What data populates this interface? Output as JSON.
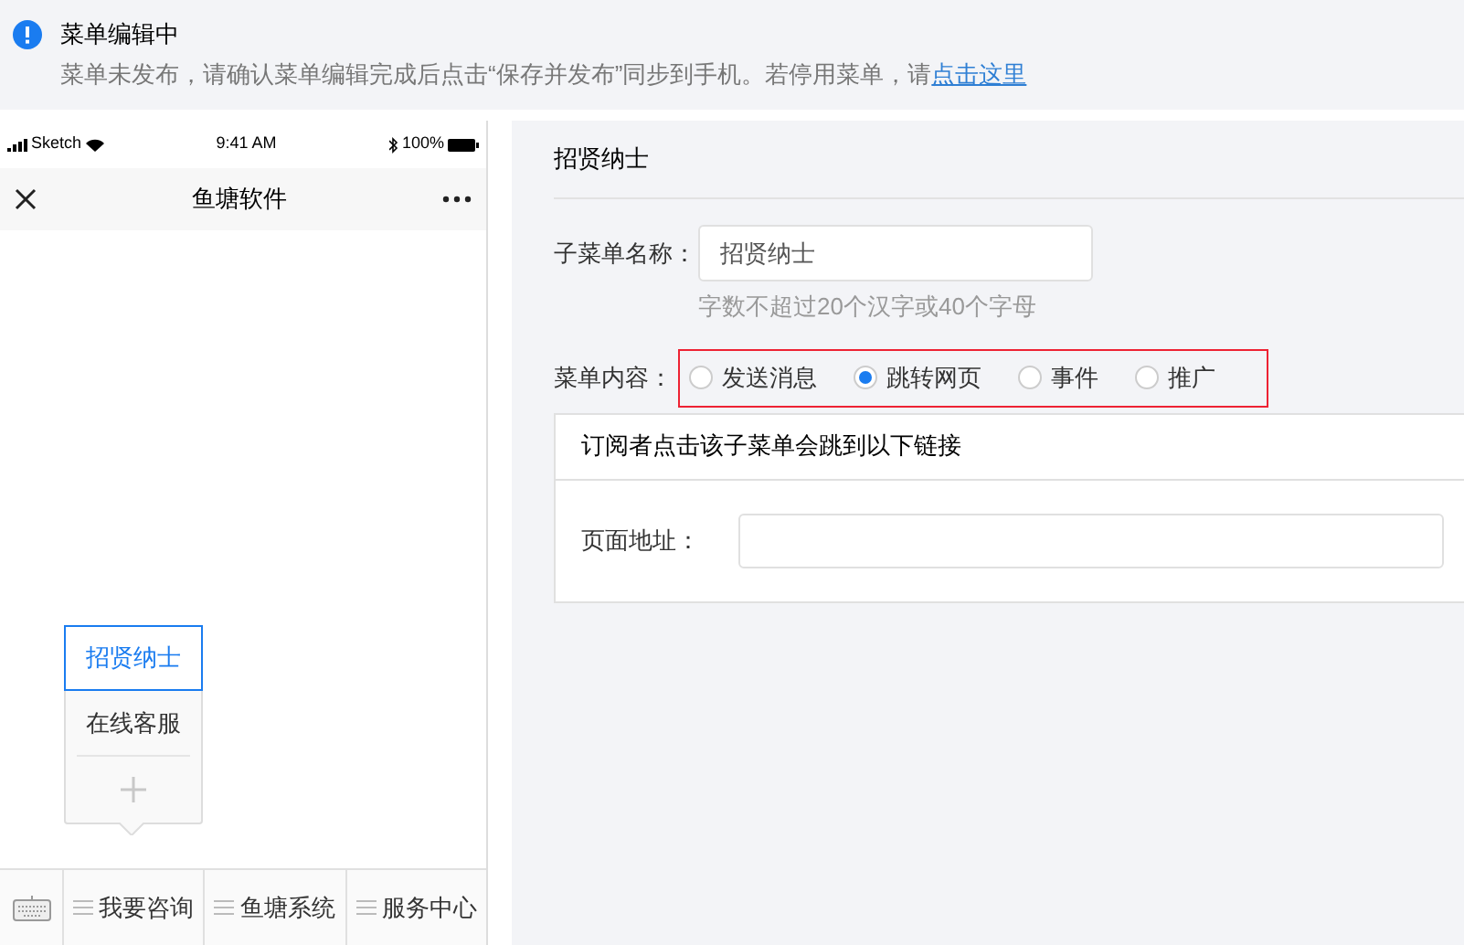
{
  "notice": {
    "title": "菜单编辑中",
    "message": "菜单未发布，请确认菜单编辑完成后点击“保存并发布”同步到手机。若停用菜单，请",
    "link": "点击这里"
  },
  "phone": {
    "status": {
      "carrier": "Sketch",
      "time": "9:41 AM",
      "battery": "100%"
    },
    "title": "鱼塘软件",
    "submenu": [
      {
        "label": "招贤纳士",
        "selected": true
      },
      {
        "label": "在线客服",
        "selected": false
      }
    ],
    "menu": [
      {
        "label": "我要咨询"
      },
      {
        "label": "鱼塘系统"
      },
      {
        "label": "服务中心"
      }
    ]
  },
  "editor": {
    "title": "招贤纳士",
    "name_label": "子菜单名称：",
    "name_value": "招贤纳士",
    "name_hint": "字数不超过20个汉字或40个字母",
    "content_label": "菜单内容：",
    "options": [
      {
        "label": "发送消息",
        "selected": false
      },
      {
        "label": "跳转网页",
        "selected": true
      },
      {
        "label": "事件",
        "selected": false
      },
      {
        "label": "推广",
        "selected": false
      }
    ],
    "panel_title": "订阅者点击该子菜单会跳到以下链接",
    "url_label": "页面地址："
  }
}
